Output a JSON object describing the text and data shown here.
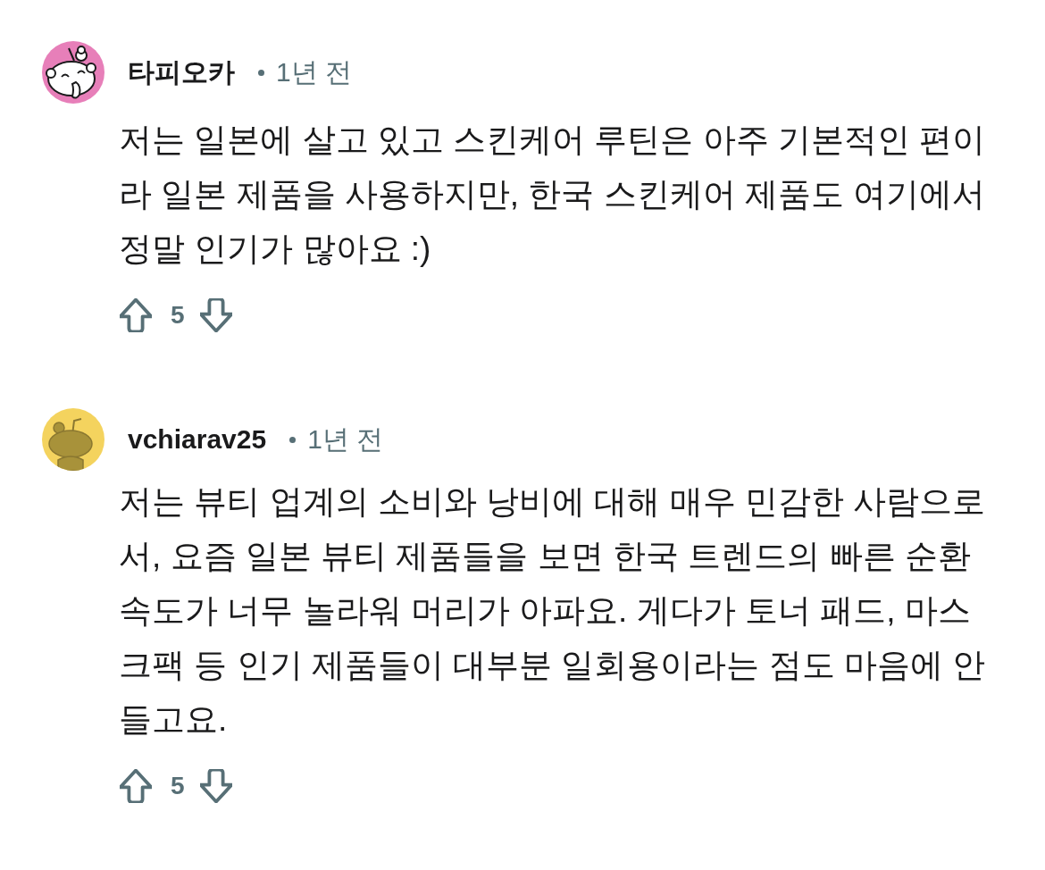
{
  "comments": [
    {
      "author": "타피오카",
      "avatar": {
        "kind": "smiling",
        "color": "#e77fb9"
      },
      "time": "1년 전",
      "body": "저는 일본에 살고 있고 스킨케어 루틴은 아주 기본적인 편이라 일본 제품을 사용하지만, 한국 스킨케어 제품도 여기에서 정말 인기가 많아요 :)",
      "votes": "5"
    },
    {
      "author": "vchiarav25",
      "avatar": {
        "kind": "silhouette",
        "color": "#f4d35e"
      },
      "time": "1년 전",
      "body": "저는 뷰티 업계의 소비와 낭비에 대해 매우 민감한 사람으로서, 요즘 일본 뷰티 제품들을 보면 한국 트렌드의 빠른 순환 속도가 너무 놀라워 머리가 아파요. 게다가 토너 패드, 마스크팩 등 인기 제품들이 대부분 일회용이라는 점도 마음에 안 들고요.",
      "votes": "5"
    }
  ]
}
